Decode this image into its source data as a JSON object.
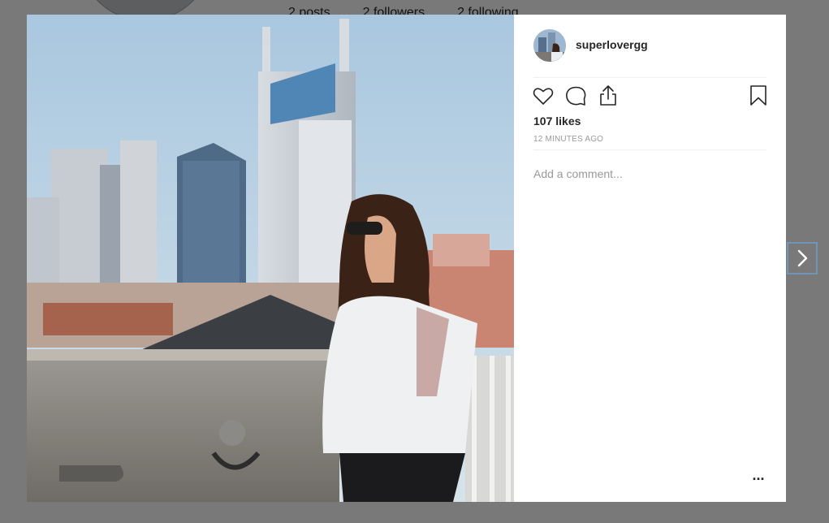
{
  "background_profile": {
    "posts": "2 posts",
    "followers": "2 followers",
    "following": "2 following"
  },
  "post": {
    "username": "superlovergg",
    "likes": "107 likes",
    "timestamp": "12 MINUTES AGO",
    "comment_placeholder": "Add a comment...",
    "more_options": "...",
    "photo_alt": "",
    "icons": {
      "like": "heart-icon",
      "comment": "comment-bubble-icon",
      "share": "share-upload-icon",
      "save": "bookmark-icon",
      "next": "chevron-right-icon"
    }
  },
  "colors": {
    "text": "#262626",
    "muted": "#999999",
    "divider": "#efefef",
    "next_border": "#6f95b8"
  }
}
